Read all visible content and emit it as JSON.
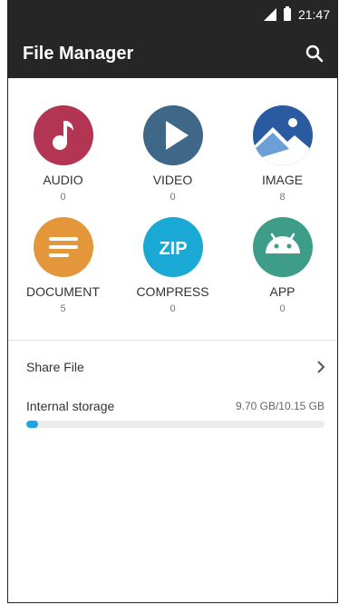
{
  "status_bar": {
    "time": "21:47"
  },
  "app_bar": {
    "title": "File Manager"
  },
  "categories": [
    {
      "label": "AUDIO",
      "count": "0",
      "icon": "music-note-icon",
      "color": "#b23553"
    },
    {
      "label": "VIDEO",
      "count": "0",
      "icon": "play-icon",
      "color": "#3f6787"
    },
    {
      "label": "IMAGE",
      "count": "8",
      "icon": "mountain-image-icon",
      "color": "#2a5aa0"
    },
    {
      "label": "DOCUMENT",
      "count": "5",
      "icon": "document-lines-icon",
      "color": "#e3973a"
    },
    {
      "label": "COMPRESS",
      "count": "0",
      "icon": "zip-icon",
      "color": "#1aa9d4"
    },
    {
      "label": "APP",
      "count": "0",
      "icon": "android-icon",
      "color": "#3e9d88"
    }
  ],
  "share": {
    "label": "Share File"
  },
  "storage": {
    "label": "Internal storage",
    "size": "9.70 GB/10.15 GB",
    "used_fraction": 0.04,
    "color": "#1ba5e0"
  }
}
